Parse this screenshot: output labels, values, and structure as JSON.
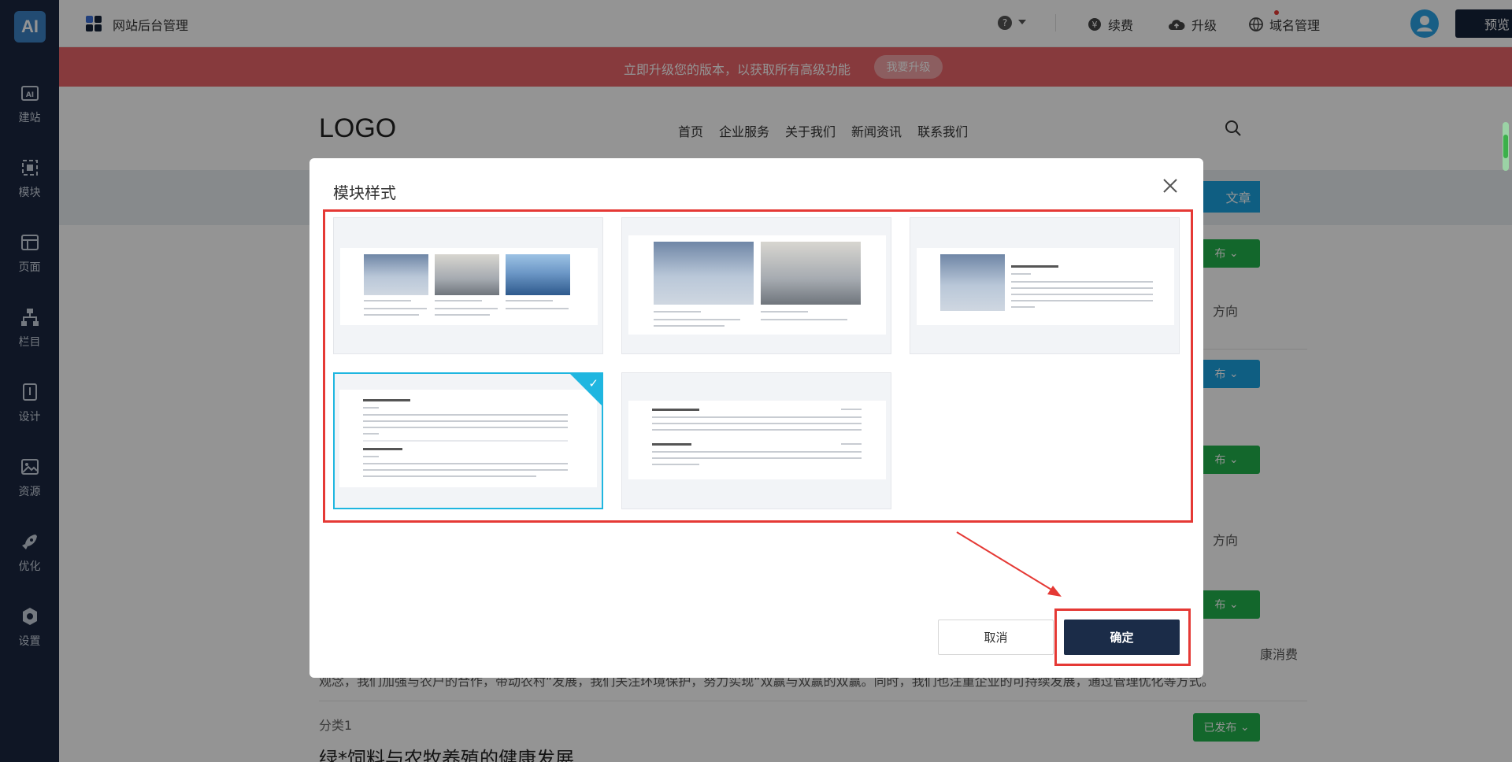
{
  "sidebar": {
    "logo": "AI",
    "items": [
      {
        "label": "建站",
        "icon": "ai-site-icon"
      },
      {
        "label": "模块",
        "icon": "module-icon"
      },
      {
        "label": "页面",
        "icon": "page-icon"
      },
      {
        "label": "栏目",
        "icon": "column-tree-icon"
      },
      {
        "label": "设计",
        "icon": "design-icon"
      },
      {
        "label": "资源",
        "icon": "resource-icon"
      },
      {
        "label": "优化",
        "icon": "rocket-icon"
      },
      {
        "label": "设置",
        "icon": "settings-icon"
      }
    ]
  },
  "header": {
    "title": "网站后台管理",
    "help": "?",
    "renew": "续费",
    "upgrade": "升级",
    "domain": "域名管理",
    "preview": "预览"
  },
  "banner": {
    "text": "立即升级您的版本，以获取所有高级功能",
    "button": "我要升级"
  },
  "site": {
    "logo": "LOGO",
    "nav": [
      "首页",
      "企业服务",
      "关于我们",
      "新闻资讯",
      "联系我们"
    ],
    "add_article": "文章",
    "badges": [
      "布",
      "布",
      "布",
      "布",
      "已发布"
    ],
    "direction": "方向",
    "paragraph_right": "康消费",
    "paragraph": "观念，我们加强与农户的合作，带动农村“发展，我们关注环境保护，努力实现“双赢与双赢的双赢。同时，我们也注重企业的可持续发展，通过管理优化等方式。",
    "category": "分类1",
    "article_title": "绿*饲料与农牧养殖的健康发展"
  },
  "modal": {
    "title": "模块样式",
    "cancel": "取消",
    "confirm": "确定",
    "selected_index": 3
  },
  "colors": {
    "sidebar": "#1a2740",
    "banner": "#e8646a",
    "accent": "#1fb6e0",
    "primary": "#1b2c48",
    "highlight": "#e53935"
  }
}
